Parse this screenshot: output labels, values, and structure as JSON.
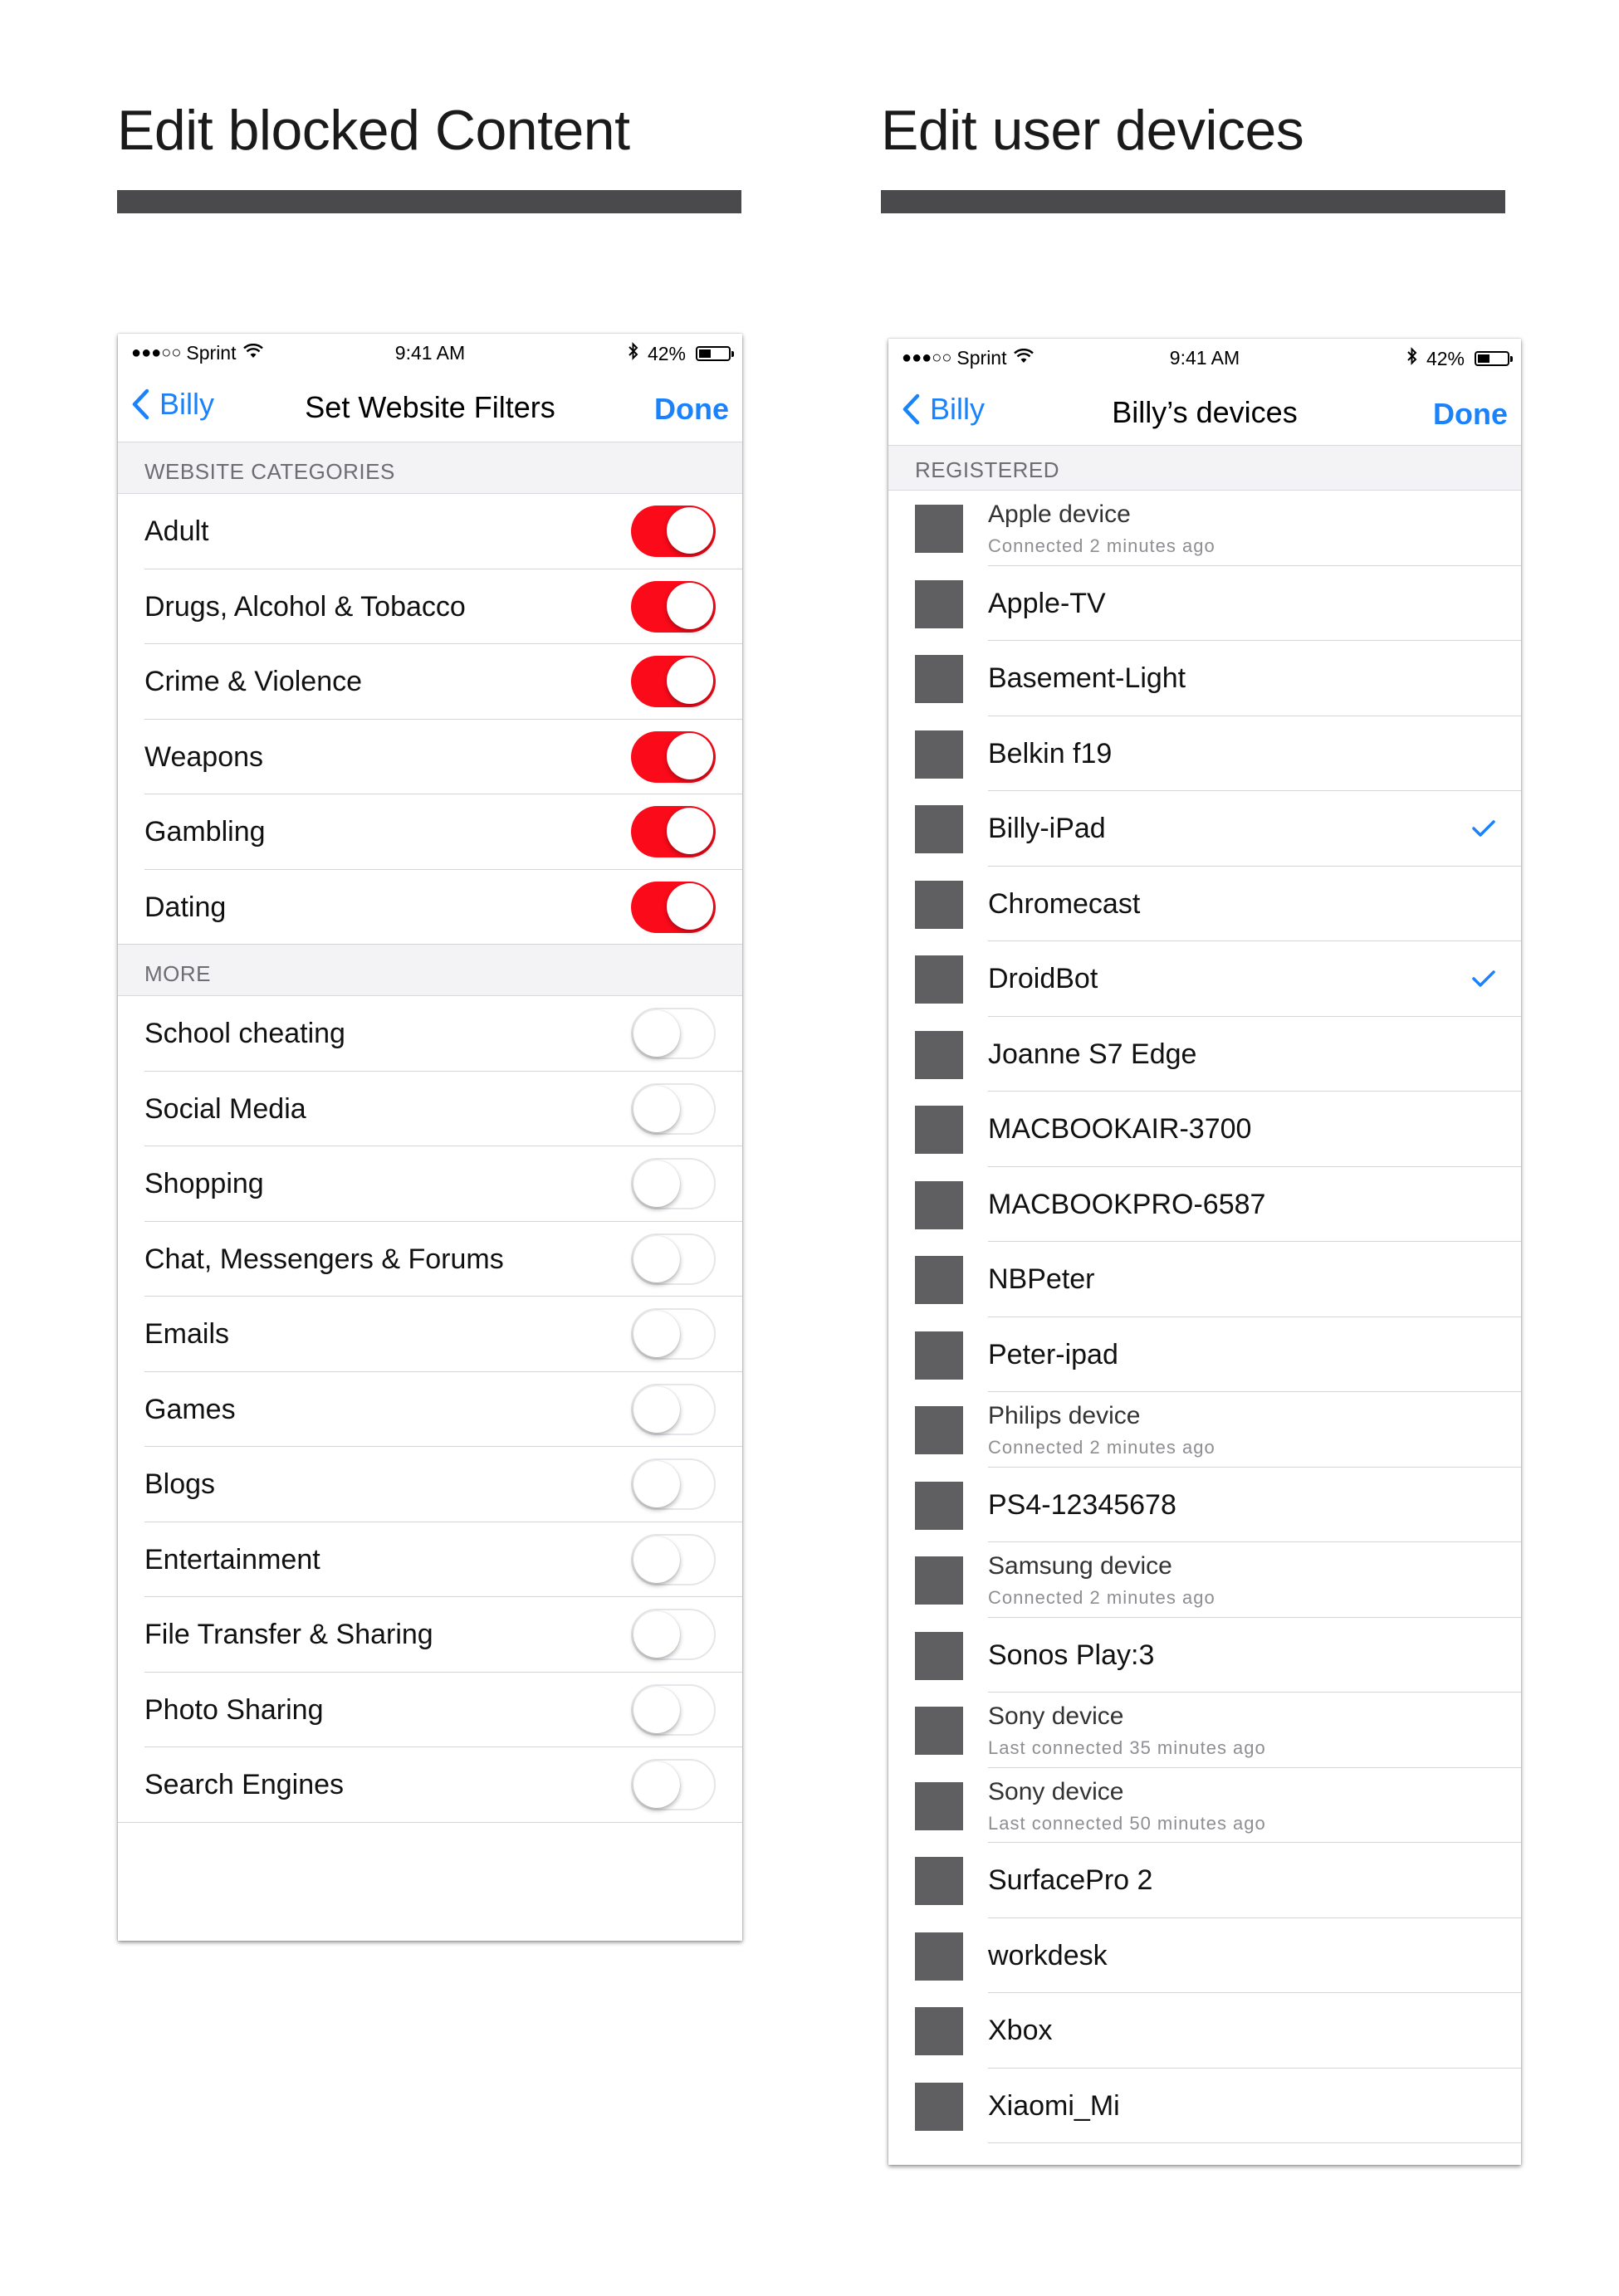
{
  "headings": {
    "left": "Edit blocked Content",
    "right": "Edit user devices"
  },
  "status_bar": {
    "carrier": "Sprint",
    "time": "9:41 AM",
    "battery": "42%",
    "battery_level": 0.42
  },
  "filters_screen": {
    "back_label": "Billy",
    "title": "Set Website Filters",
    "done_label": "Done",
    "sections": [
      {
        "header": "WEBSITE CATEGORIES",
        "items": [
          {
            "label": "Adult",
            "enabled": true
          },
          {
            "label": "Drugs, Alcohol & Tobacco",
            "enabled": true
          },
          {
            "label": "Crime & Violence",
            "enabled": true
          },
          {
            "label": "Weapons",
            "enabled": true
          },
          {
            "label": "Gambling",
            "enabled": true
          },
          {
            "label": "Dating",
            "enabled": true
          }
        ]
      },
      {
        "header": "MORE",
        "items": [
          {
            "label": "School cheating",
            "enabled": false
          },
          {
            "label": "Social Media",
            "enabled": false
          },
          {
            "label": "Shopping",
            "enabled": false
          },
          {
            "label": "Chat, Messengers & Forums",
            "enabled": false
          },
          {
            "label": "Emails",
            "enabled": false
          },
          {
            "label": "Games",
            "enabled": false
          },
          {
            "label": "Blogs",
            "enabled": false
          },
          {
            "label": "Entertainment",
            "enabled": false
          },
          {
            "label": "File Transfer & Sharing",
            "enabled": false
          },
          {
            "label": "Photo Sharing",
            "enabled": false
          },
          {
            "label": "Search Engines",
            "enabled": false
          }
        ]
      }
    ],
    "toggle_colors": {
      "on": "#fb0a1a",
      "off": "#ffffff"
    }
  },
  "devices_screen": {
    "back_label": "Billy",
    "title": "Billy’s devices",
    "done_label": "Done",
    "section_header": "REGISTERED",
    "devices": [
      {
        "name": "Apple device",
        "subtitle": "Connected 2 minutes ago",
        "checked": false
      },
      {
        "name": "Apple-TV",
        "subtitle": "",
        "checked": false
      },
      {
        "name": "Basement-Light",
        "subtitle": "",
        "checked": false
      },
      {
        "name": "Belkin f19",
        "subtitle": "",
        "checked": false
      },
      {
        "name": "Billy-iPad",
        "subtitle": "",
        "checked": true
      },
      {
        "name": "Chromecast",
        "subtitle": "",
        "checked": false
      },
      {
        "name": "DroidBot",
        "subtitle": "",
        "checked": true
      },
      {
        "name": "Joanne S7 Edge",
        "subtitle": "",
        "checked": false
      },
      {
        "name": "MACBOOKAIR-3700",
        "subtitle": "",
        "checked": false
      },
      {
        "name": "MACBOOKPRO-6587",
        "subtitle": "",
        "checked": false
      },
      {
        "name": "NBPeter",
        "subtitle": "",
        "checked": false
      },
      {
        "name": "Peter-ipad",
        "subtitle": "",
        "checked": false
      },
      {
        "name": "Philips device",
        "subtitle": "Connected 2 minutes ago",
        "checked": false
      },
      {
        "name": "PS4-12345678",
        "subtitle": "",
        "checked": false
      },
      {
        "name": "Samsung device",
        "subtitle": "Connected 2 minutes ago",
        "checked": false
      },
      {
        "name": "Sonos Play:3",
        "subtitle": "",
        "checked": false
      },
      {
        "name": "Sony device",
        "subtitle": "Last connected 35 minutes ago",
        "checked": false
      },
      {
        "name": "Sony device",
        "subtitle": "Last connected 50 minutes ago",
        "checked": false
      },
      {
        "name": "SurfacePro 2",
        "subtitle": "",
        "checked": false
      },
      {
        "name": "workdesk",
        "subtitle": "",
        "checked": false
      },
      {
        "name": "Xbox",
        "subtitle": "",
        "checked": false
      },
      {
        "name": "Xiaomi_Mi",
        "subtitle": "",
        "checked": false
      }
    ],
    "accent_color": "#1a82fb",
    "device_icon_color": "#5f5f61"
  }
}
